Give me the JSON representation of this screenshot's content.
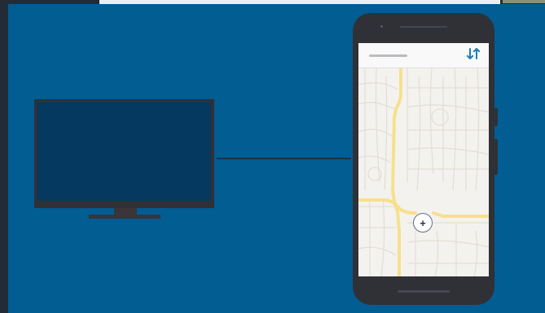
{
  "icons": {
    "swap": "swap-vertical-arrows-icon",
    "locate": "plus-icon"
  },
  "map": {
    "locate_symbol": "+"
  },
  "colors": {
    "background": "#025d93",
    "tv_screen": "#05395f",
    "device_body": "#2f3137",
    "accent": "#1a7cc1",
    "road": "#f7e08d",
    "map_background": "#f4f2ee"
  }
}
